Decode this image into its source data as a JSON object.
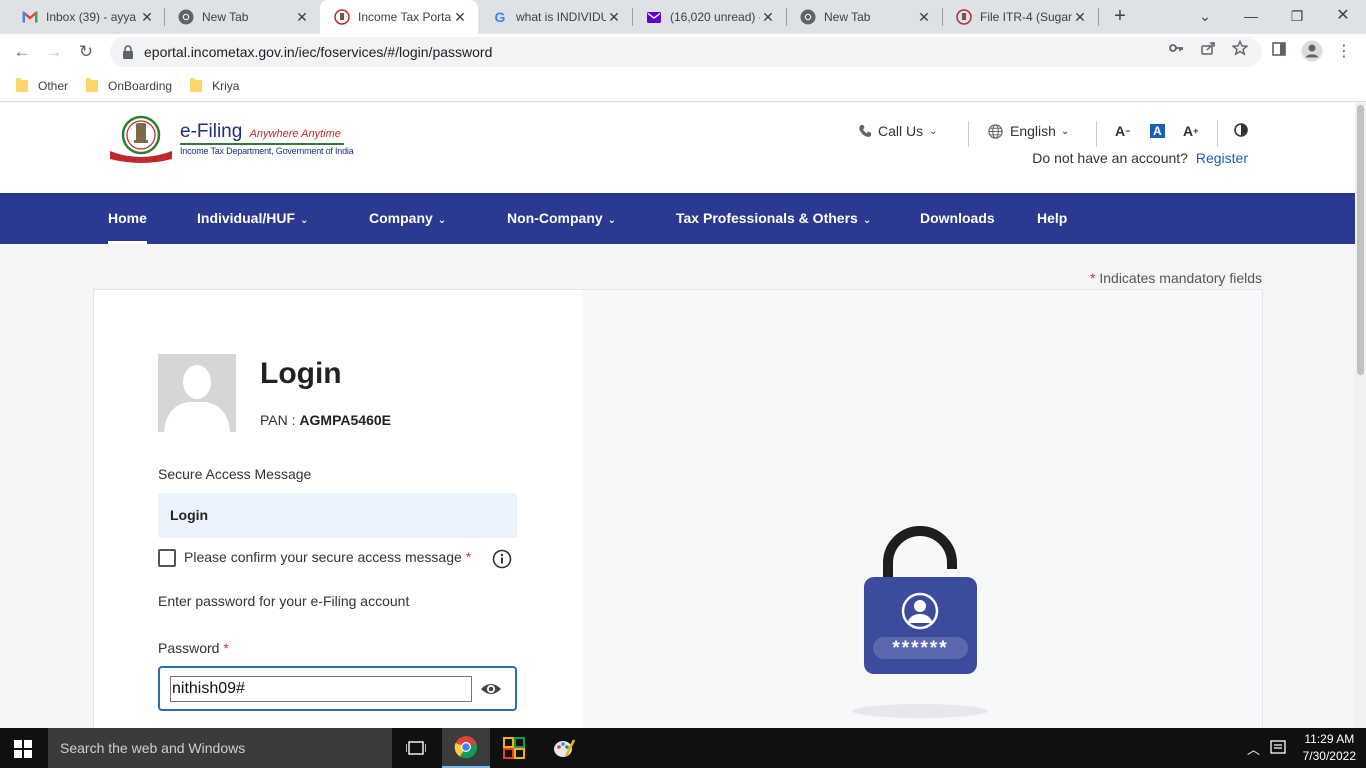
{
  "browser": {
    "tabs": [
      {
        "title": "Inbox (39) - ayya",
        "icon": "gmail-icon"
      },
      {
        "title": "New Tab",
        "icon": "chrome-icon"
      },
      {
        "title": "Income Tax Porta",
        "icon": "emblem-icon"
      },
      {
        "title": "what is INDIVIDU",
        "icon": "google-icon"
      },
      {
        "title": "(16,020 unread) -",
        "icon": "yahoo-mail-icon"
      },
      {
        "title": "New Tab",
        "icon": "chrome-icon"
      },
      {
        "title": "File ITR-4 (Sugam",
        "icon": "emblem-icon"
      }
    ],
    "url": "eportal.incometax.gov.in/iec/foservices/#/login/password",
    "bookmarks": [
      "Other",
      "OnBoarding",
      "Kriya"
    ]
  },
  "site": {
    "logo_title": "e-Filing",
    "logo_tagline": "Anywhere Anytime",
    "logo_subtitle": "Income Tax Department, Government of India",
    "call_us": "Call Us",
    "language": "English",
    "no_account": "Do not have an account?",
    "register": "Register",
    "nav": [
      "Home",
      "Individual/HUF",
      "Company",
      "Non-Company",
      "Tax Professionals & Others",
      "Downloads",
      "Help"
    ]
  },
  "login": {
    "mandatory_note": "Indicates mandatory fields",
    "title": "Login",
    "pan_label": "PAN :",
    "pan_value": "AGMPA5460E",
    "secure_access_label": "Secure Access Message",
    "secure_access_message": "Login",
    "confirm_label": "Please confirm your secure access message",
    "enter_password_text": "Enter password for your e-Filing account",
    "password_label": "Password",
    "password_value": "nithish09#",
    "lock_mask": "******"
  },
  "taskbar": {
    "search_placeholder": "Search the web and Windows",
    "time": "11:29 AM",
    "date": "7/30/2022"
  },
  "colors": {
    "nav_bg": "#2b3990",
    "link": "#1a5fb4",
    "required": "#d32f2f",
    "lock_body": "#3d4b9c"
  }
}
